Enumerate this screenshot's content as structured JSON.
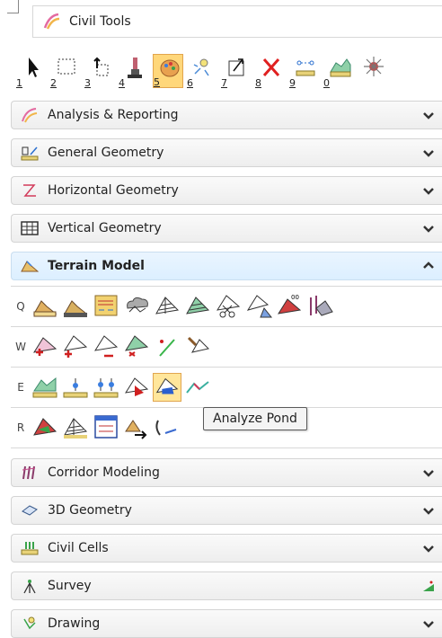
{
  "window": {
    "title": "Civil Tools"
  },
  "toolbar": {
    "tools": [
      {
        "num": "1",
        "icon": "select-arrow-icon"
      },
      {
        "num": "2",
        "icon": "marquee-select-icon"
      },
      {
        "num": "3",
        "icon": "move-element-icon"
      },
      {
        "num": "4",
        "icon": "paint-brush-icon"
      },
      {
        "num": "5",
        "icon": "paint-palette-icon",
        "selected": true
      },
      {
        "num": "6",
        "icon": "highlight-element-icon"
      },
      {
        "num": "7",
        "icon": "scale-element-icon"
      },
      {
        "num": "8",
        "icon": "delete-x-icon"
      },
      {
        "num": "9",
        "icon": "measure-distance-icon"
      },
      {
        "num": "0",
        "icon": "terrain-profile-icon"
      },
      {
        "num": "",
        "icon": "sparkle-icon"
      }
    ]
  },
  "sections": {
    "analysis": {
      "label": "Analysis & Reporting"
    },
    "general": {
      "label": "General Geometry"
    },
    "horizontal": {
      "label": "Horizontal Geometry"
    },
    "vertical": {
      "label": "Vertical Geometry"
    },
    "terrain": {
      "label": "Terrain Model"
    },
    "corridor": {
      "label": "Corridor Modeling"
    },
    "geometry3d": {
      "label": "3D Geometry"
    },
    "civilcells": {
      "label": "Civil Cells"
    },
    "survey": {
      "label": "Survey"
    },
    "drawing": {
      "label": "Drawing"
    }
  },
  "terrain_rows": [
    {
      "key": "Q",
      "count": 10
    },
    {
      "key": "W",
      "count": 6
    },
    {
      "key": "E",
      "count": 6
    },
    {
      "key": "R",
      "count": 5
    }
  ],
  "tooltip": {
    "text": "Analyze Pond"
  },
  "colors": {
    "accent_selected": "#ffd77a",
    "open_section_bg": "#dcefff"
  }
}
